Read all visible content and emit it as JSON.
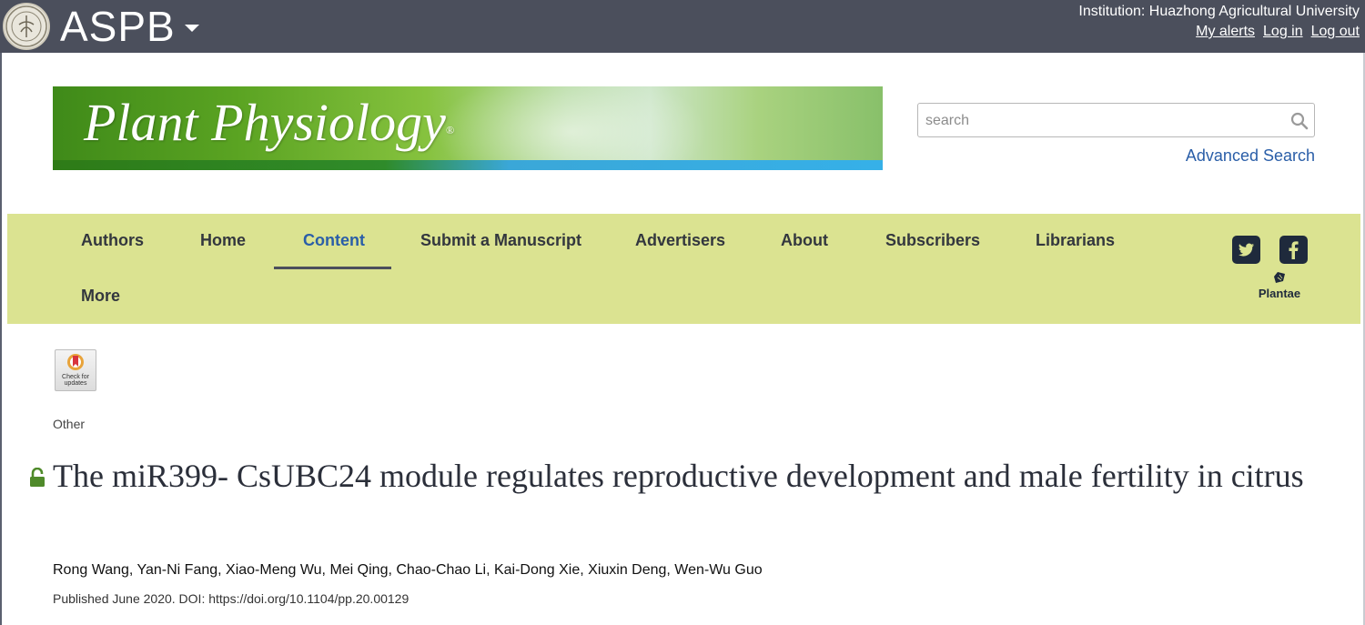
{
  "topbar": {
    "brand": "ASPB",
    "institution": "Institution: Huazhong Agricultural University",
    "links": [
      "My alerts",
      "Log in",
      "Log out"
    ]
  },
  "banner": {
    "title": "Plant Physiology",
    "registered": "®"
  },
  "search": {
    "placeholder": "search",
    "value": "",
    "advanced": "Advanced Search"
  },
  "nav": {
    "items": [
      "Authors",
      "Home",
      "Content",
      "Submit a Manuscript",
      "Advertisers",
      "About",
      "Subscribers",
      "Librarians",
      "More"
    ],
    "active": "Content",
    "plantae": "Plantae"
  },
  "article": {
    "check_updates": "Check for updates",
    "type": "Other",
    "title": "The miR399- CsUBC24 module regulates reproductive development and male fertility in citrus",
    "authors": "Rong Wang, Yan-Ni Fang, Xiao-Meng Wu, Mei Qing, Chao-Chao Li, Kai-Dong Xie, Xiuxin Deng, Wen-Wu Guo",
    "published": "Published June 2020. DOI: https://doi.org/10.1104/pp.20.00129"
  },
  "colors": {
    "topbar": "#4b4f5c",
    "nav_bg": "#dbe391",
    "link": "#2a5ea8",
    "lock": "#4f8a2a"
  }
}
